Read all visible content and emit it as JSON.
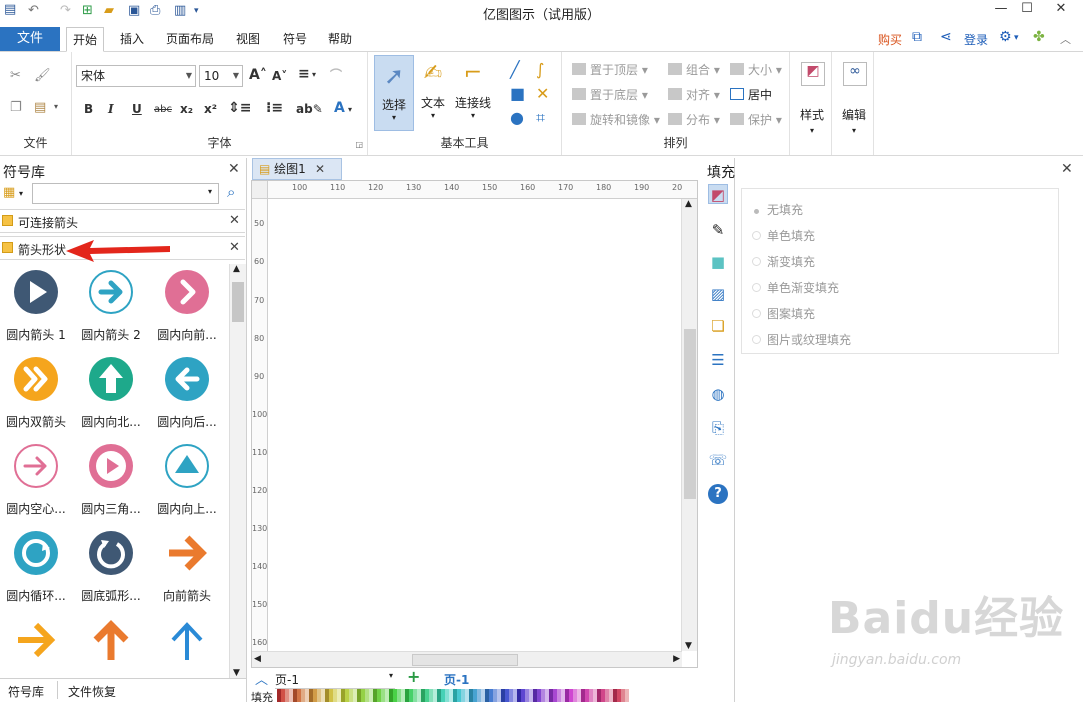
{
  "titlebar": {
    "title": "亿图图示（试用版）"
  },
  "menu": {
    "file": "文件",
    "tabs": [
      "开始",
      "插入",
      "页面布局",
      "视图",
      "符号",
      "帮助"
    ],
    "buy": "购买",
    "login": "登录"
  },
  "ribbon": {
    "groups": {
      "file": "文件",
      "font": "字体",
      "basic_tools": "基本工具",
      "arrange": "排列"
    },
    "font_name": "宋体",
    "font_size": "10",
    "tools": {
      "select": "选择",
      "text": "文本",
      "connector": "连接线"
    },
    "arrange": {
      "bring_front": "置于顶层",
      "send_back": "置于底层",
      "rotate_mirror": "旋转和镜像",
      "group": "组合",
      "align": "对齐",
      "distribute": "分布",
      "size": "大小",
      "center": "居中",
      "protect": "保护"
    },
    "style": "样式",
    "edit": "编辑"
  },
  "symbol_library": {
    "title": "符号库",
    "search_value": "",
    "libraries": [
      "可连接箭头",
      "箭头形状"
    ],
    "shapes": [
      {
        "label": "圆内箭头 1",
        "icon": "circle-arrow-right-dark",
        "color": "#3f5874"
      },
      {
        "label": "圆内箭头 2",
        "icon": "circle-outline-arrow-right",
        "color": "#2ea3c3"
      },
      {
        "label": "圆内向前...",
        "icon": "circle-chevron-right",
        "color": "#e06f95"
      },
      {
        "label": "圆内双箭头",
        "icon": "circle-double-chevron",
        "color": "#f5a51d"
      },
      {
        "label": "圆内向北...",
        "icon": "circle-arrow-up",
        "color": "#1ea98b"
      },
      {
        "label": "圆内向后...",
        "icon": "circle-arrow-left",
        "color": "#2ea3c3"
      },
      {
        "label": "圆内空心...",
        "icon": "circle-outline-arrow",
        "color": "#e06f95"
      },
      {
        "label": "圆内三角...",
        "icon": "circle-triangle-right",
        "color": "#e06f95"
      },
      {
        "label": "圆内向上...",
        "icon": "circle-outline-triangle-up",
        "color": "#2ea3c3"
      },
      {
        "label": "圆内循环...",
        "icon": "circle-refresh",
        "color": "#2ea3c3"
      },
      {
        "label": "圆底弧形...",
        "icon": "circle-arc-arrow",
        "color": "#3f5874"
      },
      {
        "label": "向前箭头",
        "icon": "arrow-right",
        "color": "#ea7a2e"
      },
      {
        "label": "",
        "icon": "arrow-right-yellow",
        "color": "#f5a51d"
      },
      {
        "label": "",
        "icon": "arrow-up-orange",
        "color": "#ea7a2e"
      },
      {
        "label": "",
        "icon": "arrow-up-blue",
        "color": "#2a8ad6"
      }
    ],
    "bottom_tabs": [
      "符号库",
      "文件恢复"
    ]
  },
  "canvas": {
    "doc_tab": "绘图1",
    "hruler": [
      "100",
      "110",
      "120",
      "130",
      "140",
      "150",
      "160",
      "170",
      "180",
      "190",
      "20"
    ],
    "vruler": [
      "50",
      "60",
      "70",
      "80",
      "90",
      "100",
      "110",
      "120",
      "130",
      "140",
      "150",
      "160"
    ],
    "page_select": "页-1",
    "page_tab": "页-1",
    "fill_label": "填充"
  },
  "fill_panel": {
    "title": "填充",
    "options": [
      "无填充",
      "单色填充",
      "渐变填充",
      "单色渐变填充",
      "图案填充",
      "图片或纹理填充"
    ],
    "selected": "无填充"
  },
  "watermark": {
    "logo": "Baidu经验",
    "url": "jingyan.baidu.com"
  }
}
